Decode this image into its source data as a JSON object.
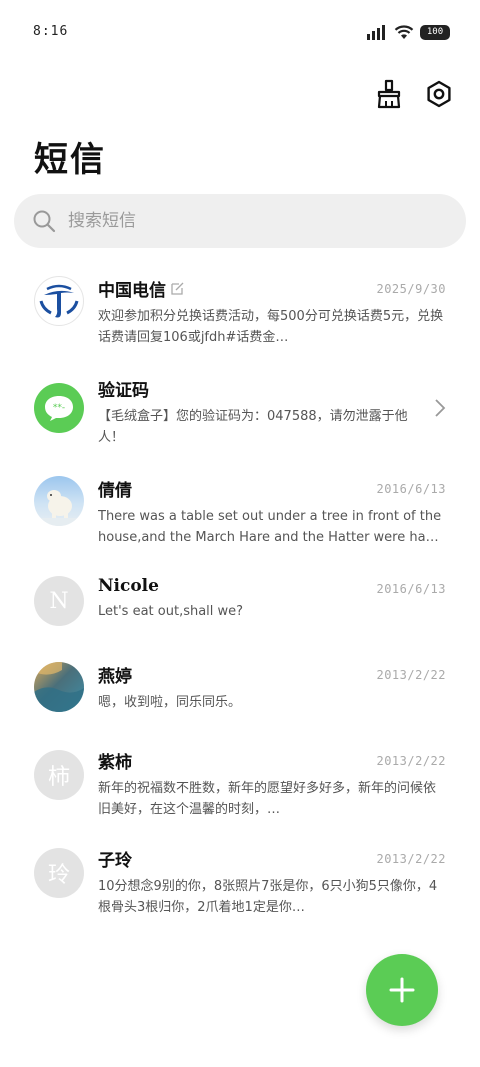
{
  "status_bar": {
    "time": "8:16",
    "battery": "100"
  },
  "header": {
    "title": "短信",
    "clean_icon": "broom-icon",
    "settings_icon": "gear-icon"
  },
  "search": {
    "placeholder": "搜索短信"
  },
  "colors": {
    "accent": "#5bcc55",
    "search_bg": "#efefef",
    "avatar_gray": "#e3e3e3"
  },
  "messages": [
    {
      "name": "中国电信",
      "date": "2025/9/30",
      "preview": "欢迎参加积分兑换话费活动，每500分可兑换话费5元，兑换话费请回复106或jfdh#话费金…",
      "avatar": "china-telecom-logo",
      "edit_icon": "edit-icon"
    },
    {
      "name": "验证码",
      "date": "",
      "preview": "【毛绒盒子】您的验证码为：047588，请勿泄露于他人！",
      "avatar": "sms-bubble-icon",
      "chevron": "chevron-right-icon"
    },
    {
      "name": "倩倩",
      "date": "2016/6/13",
      "preview": "There was a table set out under a tree in front of the house,and the March Hare and the Hatter were having t…",
      "avatar": "polar-bear-photo"
    },
    {
      "name": "Nicole",
      "date": "2016/6/13",
      "preview": "Let's eat out,shall we?",
      "avatar_letter": "N"
    },
    {
      "name": "燕婷",
      "date": "2013/2/22",
      "preview": "嗯，收到啦，同乐同乐。",
      "avatar": "landscape-photo"
    },
    {
      "name": "紫柿",
      "date": "2013/2/22",
      "preview": "新年的祝福数不胜数，新年的愿望好多好多，新年的问候依旧美好，在这个温馨的时刻，…",
      "avatar_letter": "柿"
    },
    {
      "name": "子玲",
      "date": "2013/2/22",
      "preview": "10分想念9别的你，8张照片7张是你，6只小狗5只像你，4根骨头3根归你，2爪着地1定是你…",
      "avatar_letter": "玲"
    }
  ]
}
